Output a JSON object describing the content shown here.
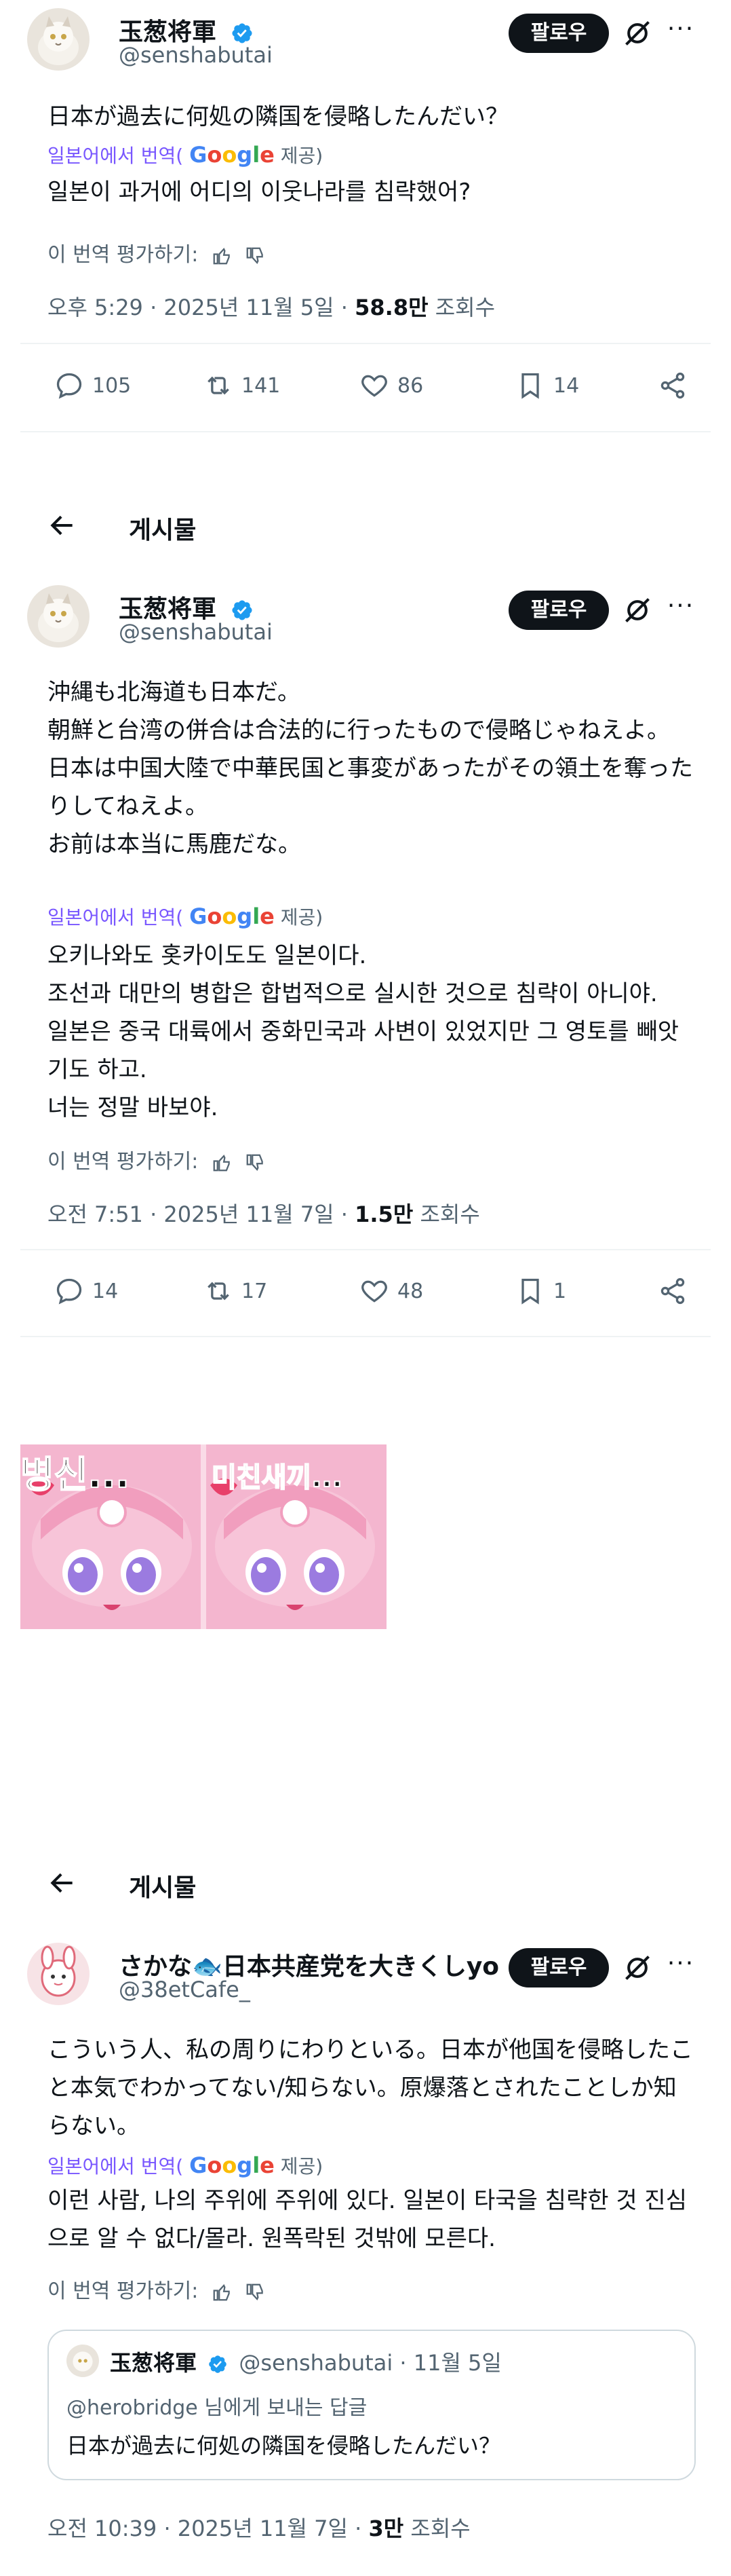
{
  "tweet1": {
    "name": "玉葱将軍",
    "handle": "@senshabutai",
    "follow_label": "팔로우",
    "more_label": "···",
    "text": "日本が過去に何処の隣国を侵略したんだい？",
    "translated_from": "일본어에서 번역(",
    "google_label": "Google",
    "provided": " 제공)",
    "translation": "일본이 과거에 어디의 이웃나라를 침략했어?",
    "rate_label": "이 번역 평가하기:",
    "time": "오후 5:29 · 2025년 11월 5일 · ",
    "views_count": "58.8만",
    "views_label": " 조회수",
    "replies": "105",
    "retweets": "141",
    "likes": "86",
    "bookmarks": "14"
  },
  "post2": {
    "title": "게시물",
    "name": "玉葱将軍",
    "handle": "@senshabutai",
    "follow_label": "팔로우",
    "more_label": "···",
    "text": "沖縄も北海道も日本だ。\n朝鮮と台湾の併合は合法的に行ったもので侵略じゃねえよ。\n日本は中国大陸で中華民国と事変があったがその領土を奪ったりしてねえよ。\nお前は本当に馬鹿だな。",
    "translated_from": "일본어에서 번역(",
    "google_label": "Google",
    "provided": " 제공)",
    "translation": "오키나와도 홋카이도도 일본이다.\n조선과 대만의 병합은 합법적으로 실시한 것으로 침략이 아니야.\n일본은 중국 대륙에서 중화민국과 사변이 있었지만 그 영토를 빼앗기도 하고.\n너는 정말 바보야.",
    "rate_label": "이 번역 평가하기:",
    "time": "오전 7:51 · 2025년 11월 7일 · ",
    "views_count": "1.5만",
    "views_label": " 조회수",
    "replies": "14",
    "retweets": "17",
    "likes": "48",
    "bookmarks": "1"
  },
  "meme": {
    "left_caption": "병신...",
    "right_caption": "미친새끼..."
  },
  "post3": {
    "title": "게시물",
    "name": "さかな🐟日本共産党を大きくしyo",
    "handle": "@38etCafe_",
    "follow_label": "팔로우",
    "more_label": "···",
    "text": "こういう人、私の周りにわりといる。日本が他国を侵略したこと本気でわかってない/知らない。原爆落とされたことしか知らない。",
    "translated_from": "일본어에서 번역(",
    "google_label": "Google",
    "provided": " 제공)",
    "translation": "이런 사람, 나의 주위에 주위에 있다. 일본이 타국을 침략한 것 진심으로 알 수 없다/몰라. 원폭락된 것밖에 모른다.",
    "rate_label": "이 번역 평가하기:",
    "quote": {
      "name": "玉葱将軍",
      "handle_date": "@senshabutai · 11월 5일",
      "reply_to": "@herobridge 님에게 보내는 답글",
      "text": "日本が過去に何処の隣国を侵略したんだい？"
    },
    "time": "오전 10:39 · 2025년 11월 7일 · ",
    "views_count": "3만",
    "views_label": " 조회수"
  },
  "colors": {
    "text": "#0f1419",
    "muted": "#536471",
    "verified": "#1d9bf0",
    "translate_link": "#7856ff",
    "meme_pink": "#f4b6cf"
  }
}
